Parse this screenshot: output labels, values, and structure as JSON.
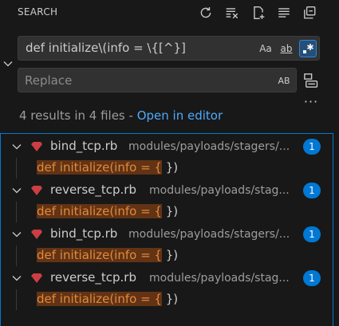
{
  "header": {
    "title": "SEARCH",
    "icons": [
      "refresh-icon",
      "clear-results-icon",
      "new-search-editor-icon",
      "view-as-tree-icon",
      "collapse-all-icon"
    ]
  },
  "search": {
    "value": "def initialize\\(info = \\{[^}]",
    "options": {
      "match_case": "Aa",
      "whole_word": "ab",
      "regex_active": true
    }
  },
  "replace": {
    "placeholder": "Replace",
    "preserve_case": "AB"
  },
  "summary": {
    "count_text": "4 results in 4 files - ",
    "open_in_editor": "Open in editor"
  },
  "results": [
    {
      "file": "bind_tcp.rb",
      "path": "modules/payloads/stagers/...",
      "count": "1",
      "match_highlight": "def initialize(info = {",
      "match_rest": " })"
    },
    {
      "file": "reverse_tcp.rb",
      "path": "modules/payloads/stag...",
      "count": "1",
      "match_highlight": "def initialize(info = {",
      "match_rest": " })"
    },
    {
      "file": "bind_tcp.rb",
      "path": "modules/payloads/stagers/...",
      "count": "1",
      "match_highlight": "def initialize(info = {",
      "match_rest": " })"
    },
    {
      "file": "reverse_tcp.rb",
      "path": "modules/payloads/stag...",
      "count": "1",
      "match_highlight": "def initialize(info = {",
      "match_rest": " })"
    }
  ],
  "colors": {
    "background": "#181818",
    "accent": "#0078d4",
    "link": "#4daafc",
    "match_highlight_bg": "#623315",
    "ruby_icon": "#cc3e44"
  }
}
